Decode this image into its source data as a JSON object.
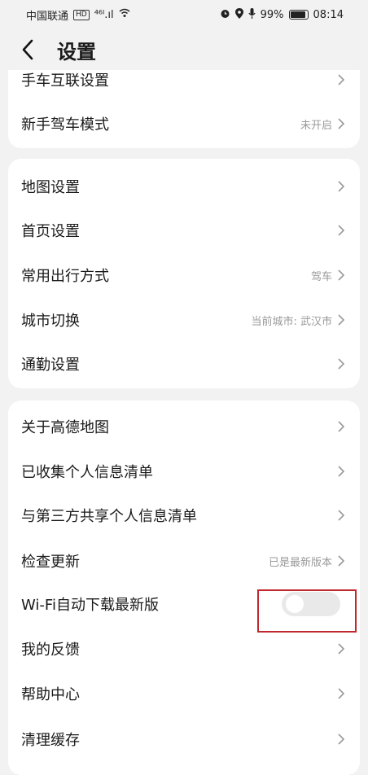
{
  "status_bar": {
    "carrier": "中国联通",
    "hd": "HD",
    "signal": "⁴⁶ˡ.ıl",
    "battery_percent": "99%",
    "time": "08:14"
  },
  "header": {
    "title": "设置"
  },
  "sections": [
    {
      "items": [
        {
          "label": "手车互联设置",
          "value": ""
        },
        {
          "label": "新手驾车模式",
          "value": "未开启"
        }
      ]
    },
    {
      "items": [
        {
          "label": "地图设置",
          "value": ""
        },
        {
          "label": "首页设置",
          "value": ""
        },
        {
          "label": "常用出行方式",
          "value": "驾车"
        },
        {
          "label": "城市切换",
          "value": "当前城市: 武汉市"
        },
        {
          "label": "通勤设置",
          "value": ""
        }
      ]
    },
    {
      "items": [
        {
          "label": "关于高德地图",
          "value": ""
        },
        {
          "label": "已收集个人信息清单",
          "value": ""
        },
        {
          "label": "与第三方共享个人信息清单",
          "value": ""
        },
        {
          "label": "检查更新",
          "value": "已是最新版本"
        },
        {
          "label": "Wi-Fi自动下载最新版",
          "toggle_on": false
        },
        {
          "label": "我的反馈",
          "value": ""
        },
        {
          "label": "帮助中心",
          "value": ""
        },
        {
          "label": "清理缓存",
          "value": ""
        }
      ]
    }
  ],
  "colors": {
    "background": "#f2f2f2",
    "card": "#ffffff",
    "highlight_box": "#c0282d",
    "secondary_text": "#9a9a9a"
  }
}
